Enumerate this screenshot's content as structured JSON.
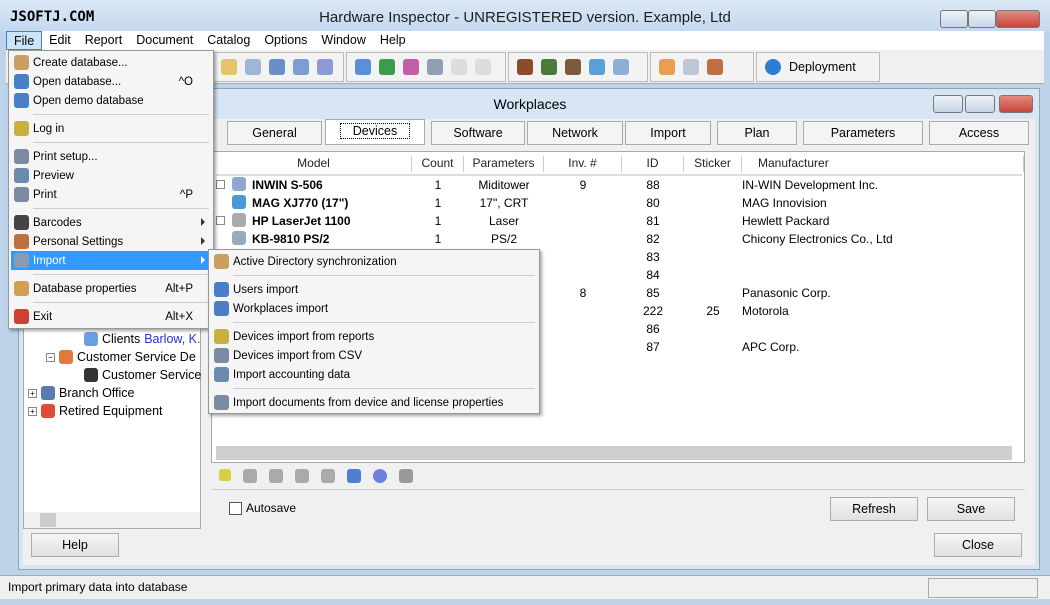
{
  "window": {
    "title": "Hardware Inspector - UNREGISTERED version. Example, Ltd",
    "watermark": "JSOFTJ.COM"
  },
  "menubar": [
    "File",
    "Edit",
    "Report",
    "Document",
    "Catalog",
    "Options",
    "Window",
    "Help"
  ],
  "toolbar": {
    "deployment_label": "Deployment"
  },
  "child": {
    "title": "Workplaces",
    "tabs": [
      "General",
      "Devices",
      "Software",
      "Network",
      "Import",
      "Plan",
      "Parameters",
      "Access"
    ],
    "selected_tab": "Devices",
    "tree": [
      {
        "label": "Clients",
        "extra": "Barlow, K."
      },
      {
        "label": "Customer Service De"
      },
      {
        "label": "Customer Service"
      },
      {
        "label": "Branch Office"
      },
      {
        "label": "Retired Equipment"
      }
    ],
    "grid": {
      "columns": [
        "Model",
        "Count",
        "Parameters",
        "Inv. #",
        "ID",
        "Sticker",
        "Manufacturer"
      ],
      "rows": [
        [
          "INWIN S-506",
          "1",
          "Miditower",
          "9",
          "88",
          "",
          "IN-WIN Development Inc."
        ],
        [
          "MAG XJ770 (17\")",
          "1",
          "17\", CRT",
          "",
          "80",
          "",
          "MAG Innovision"
        ],
        [
          "HP LaserJet 1100",
          "1",
          "Laser",
          "",
          "81",
          "",
          "Hewlett Packard"
        ],
        [
          "KB-9810 PS/2",
          "1",
          "PS/2",
          "",
          "82",
          "",
          "Chicony Electronics Co., Ltd"
        ],
        [
          "",
          "",
          "",
          "",
          "83",
          "",
          ""
        ],
        [
          "",
          "",
          "",
          "",
          "84",
          "",
          ""
        ],
        [
          "",
          "",
          "",
          "8",
          "85",
          "",
          "Panasonic Corp."
        ],
        [
          "",
          "",
          "",
          "",
          "222",
          "25",
          "Motorola"
        ],
        [
          "",
          "",
          "",
          "",
          "86",
          "",
          ""
        ],
        [
          "",
          "",
          "",
          "",
          "87",
          "",
          "APC Corp."
        ]
      ]
    },
    "autosave_label": "Autosave",
    "autosave_checked": false,
    "refresh_label": "Refresh",
    "save_label": "Save",
    "help_label": "Help",
    "close_label": "Close"
  },
  "file_menu": [
    {
      "label": "Create database...",
      "shortcut": ""
    },
    {
      "label": "Open database...",
      "shortcut": "^O"
    },
    {
      "label": "Open demo database",
      "shortcut": ""
    },
    {
      "sep": true
    },
    {
      "label": "Log in",
      "shortcut": ""
    },
    {
      "sep": true
    },
    {
      "label": "Print setup...",
      "shortcut": ""
    },
    {
      "label": "Preview",
      "shortcut": ""
    },
    {
      "label": "Print",
      "shortcut": "^P"
    },
    {
      "sep": true
    },
    {
      "label": "Barcodes",
      "submenu": true
    },
    {
      "label": "Personal Settings",
      "submenu": true
    },
    {
      "label": "Import",
      "submenu": true,
      "highlighted": true
    },
    {
      "sep": true
    },
    {
      "label": "Database properties",
      "shortcut": "Alt+P"
    },
    {
      "sep": true
    },
    {
      "label": "Exit",
      "shortcut": "Alt+X"
    }
  ],
  "import_menu": [
    {
      "label": "Active Directory synchronization"
    },
    {
      "sep": true
    },
    {
      "label": "Users import"
    },
    {
      "label": "Workplaces import"
    },
    {
      "sep": true
    },
    {
      "label": "Devices import from reports"
    },
    {
      "label": "Devices import from CSV"
    },
    {
      "label": "Import accounting data"
    },
    {
      "sep": true
    },
    {
      "label": "Import documents from device and license properties"
    }
  ],
  "status": {
    "text": "Import primary data into database"
  },
  "colors": {
    "highlight": "#3399ff",
    "title_bg": "#c4d8ee",
    "close_btn": "#c9463d"
  }
}
